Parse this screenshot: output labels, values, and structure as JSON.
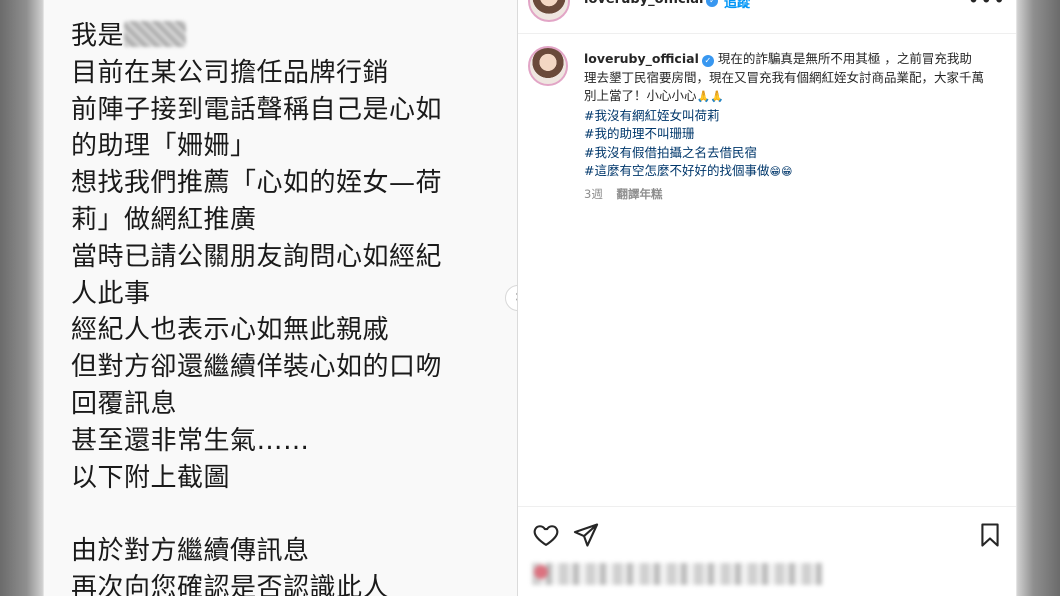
{
  "post": {
    "lines": [
      "我是",
      "目前在某公司擔任品牌行銷",
      "前陣子接到電話聲稱自己是心如",
      "的助理「姍姍」",
      "想找我們推薦「心如的姪女—荷",
      "莉」做網紅推廣",
      "當時已請公關朋友詢問心如經紀",
      "人此事",
      "經紀人也表示心如無此親戚",
      "但對方卻還繼續佯裝心如的口吻",
      "回覆訊息",
      "甚至還非常生氣……",
      "以下附上截圖",
      "由於對方繼續傳訊息",
      "再次向您確認是否認識此人"
    ],
    "next_icon": "chevron-right-icon"
  },
  "header": {
    "username": "loveruby_official",
    "dot": "•",
    "follow_label": "追蹤",
    "more_icon": "more-horizontal-icon"
  },
  "caption": {
    "username": "loveruby_official",
    "text": "現在的詐騙真是無所不用其極 ，之前冒充我助理去墾丁民宿要房間，現在又冒充我有個網紅姪女討商品業配，大家千萬別上當了！小心小心",
    "emoji_pray": "🙏🙏",
    "hashtags": [
      "#我沒有網紅姪女叫荷莉",
      "#我的助理不叫珊珊",
      "#我沒有假借拍攝之名去借民宿",
      "#這麼有空怎麼不好好的找個事做"
    ],
    "emoji_end": "😁😁",
    "time": "3週",
    "translate_label": "翻譯年糕"
  },
  "actions": {
    "like_icon": "heart-icon",
    "share_icon": "send-icon",
    "save_icon": "bookmark-icon"
  },
  "colors": {
    "link": "#0095f6",
    "hashtag": "#00376b",
    "verified": "#3897f0",
    "muted": "#8e8e8e"
  }
}
